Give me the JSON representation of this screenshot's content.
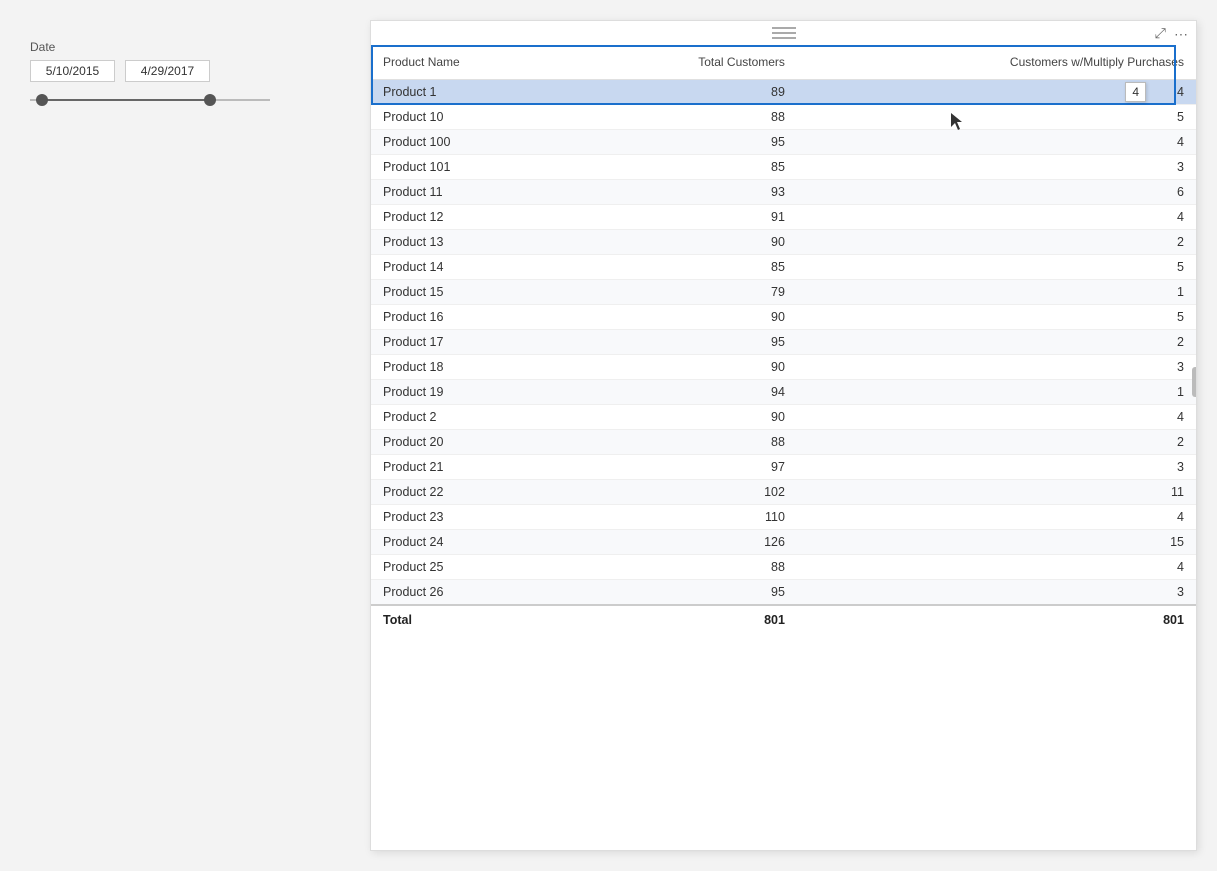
{
  "date_filter": {
    "label": "Date",
    "start_date": "5/10/2015",
    "end_date": "4/29/2017"
  },
  "table": {
    "columns": [
      {
        "id": "product_name",
        "label": "Product Name"
      },
      {
        "id": "total_customers",
        "label": "Total Customers"
      },
      {
        "id": "customers_multiply",
        "label": "Customers w/Multiply Purchases"
      }
    ],
    "rows": [
      {
        "name": "Product 1",
        "total": 89,
        "multiply": 4,
        "selected": true
      },
      {
        "name": "Product 10",
        "total": 88,
        "multiply": 5,
        "selected": false
      },
      {
        "name": "Product 100",
        "total": 95,
        "multiply": 4,
        "selected": false
      },
      {
        "name": "Product 101",
        "total": 85,
        "multiply": 3,
        "selected": false
      },
      {
        "name": "Product 11",
        "total": 93,
        "multiply": 6,
        "selected": false
      },
      {
        "name": "Product 12",
        "total": 91,
        "multiply": 4,
        "selected": false
      },
      {
        "name": "Product 13",
        "total": 90,
        "multiply": 2,
        "selected": false
      },
      {
        "name": "Product 14",
        "total": 85,
        "multiply": 5,
        "selected": false
      },
      {
        "name": "Product 15",
        "total": 79,
        "multiply": 1,
        "selected": false
      },
      {
        "name": "Product 16",
        "total": 90,
        "multiply": 5,
        "selected": false
      },
      {
        "name": "Product 17",
        "total": 95,
        "multiply": 2,
        "selected": false
      },
      {
        "name": "Product 18",
        "total": 90,
        "multiply": 3,
        "selected": false
      },
      {
        "name": "Product 19",
        "total": 94,
        "multiply": 1,
        "selected": false
      },
      {
        "name": "Product 2",
        "total": 90,
        "multiply": 4,
        "selected": false
      },
      {
        "name": "Product 20",
        "total": 88,
        "multiply": 2,
        "selected": false
      },
      {
        "name": "Product 21",
        "total": 97,
        "multiply": 3,
        "selected": false
      },
      {
        "name": "Product 22",
        "total": 102,
        "multiply": 11,
        "selected": false
      },
      {
        "name": "Product 23",
        "total": 110,
        "multiply": 4,
        "selected": false
      },
      {
        "name": "Product 24",
        "total": 126,
        "multiply": 15,
        "selected": false
      },
      {
        "name": "Product 25",
        "total": 88,
        "multiply": 4,
        "selected": false
      },
      {
        "name": "Product 26",
        "total": 95,
        "multiply": 3,
        "selected": false
      }
    ],
    "footer": {
      "label": "Total",
      "total": 801,
      "multiply": 801
    }
  },
  "icons": {
    "expand": "⤢",
    "more": "···",
    "drag_handle": "≡"
  },
  "tooltip": {
    "value": "4"
  }
}
